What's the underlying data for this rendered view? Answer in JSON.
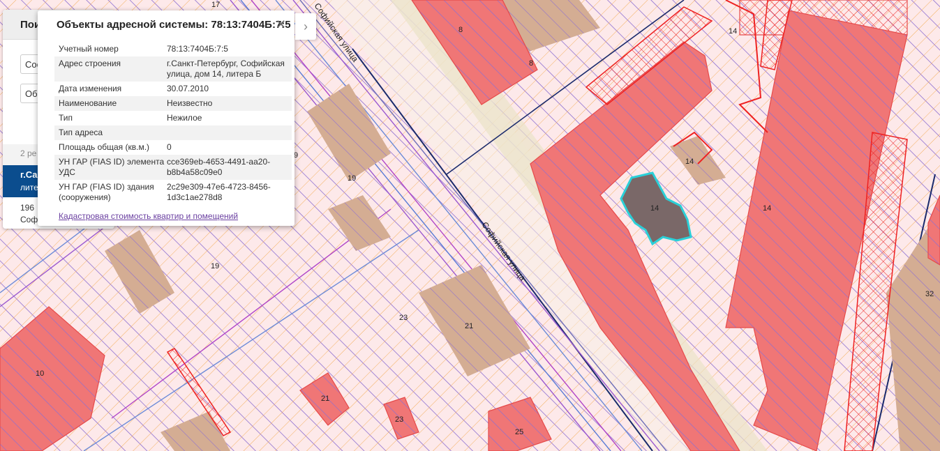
{
  "map": {
    "street_name": "Софийская улица",
    "labels": [
      "17",
      "8",
      "8",
      "14",
      "14",
      "14",
      "14",
      "9",
      "19",
      "19",
      "21",
      "23",
      "10",
      "21",
      "23",
      "25",
      "32"
    ]
  },
  "search_panel": {
    "title": "Пои",
    "input1": "Сос",
    "input2": "Об",
    "count": "2 ре",
    "result_line1": "г.Са",
    "result_line2": "лите",
    "extra_line1": "196",
    "extra_line2": "Соф"
  },
  "popup": {
    "title": "Объекты адресной системы: 78:13:7404Б:7:5",
    "close_icon": "close-icon",
    "next_icon": "chevron-right-icon",
    "rows": [
      {
        "key": "Учетный номер",
        "value": "78:13:7404Б:7:5"
      },
      {
        "key": "Адрес строения",
        "value": "г.Санкт-Петербург, Софийская улица, дом 14, литера Б"
      },
      {
        "key": "Дата изменения",
        "value": "30.07.2010"
      },
      {
        "key": "Наименование",
        "value": "Неизвестно"
      },
      {
        "key": "Тип",
        "value": "Нежилое"
      },
      {
        "key": "Тип адреса",
        "value": ""
      },
      {
        "key": "Площадь общая (кв.м.)",
        "value": "0"
      },
      {
        "key": "УН ГАР (FIAS ID) элемента УДС",
        "value": "cce369eb-4653-4491-aa20-b8b4a58c09e0"
      },
      {
        "key": "УН ГАР (FIAS ID) здания (сооружения)",
        "value": "2c29e309-47e6-4723-8456-1d3c1ae278d8"
      }
    ],
    "link": "Кадастровая стоимость квартир и помещений"
  },
  "colors": {
    "background": "#fde9ea",
    "building_fill": "#f07676",
    "building_stroke": "#e64a4a",
    "hatch": "#8d6fd1",
    "hatch_orange": "#f2a23c",
    "selection": "#2bd0d8",
    "selected_fill": "#7a6868",
    "road_line": "#1a2a6c",
    "tan": "#cfa98e",
    "panel_blue": "#0b4d8e"
  }
}
